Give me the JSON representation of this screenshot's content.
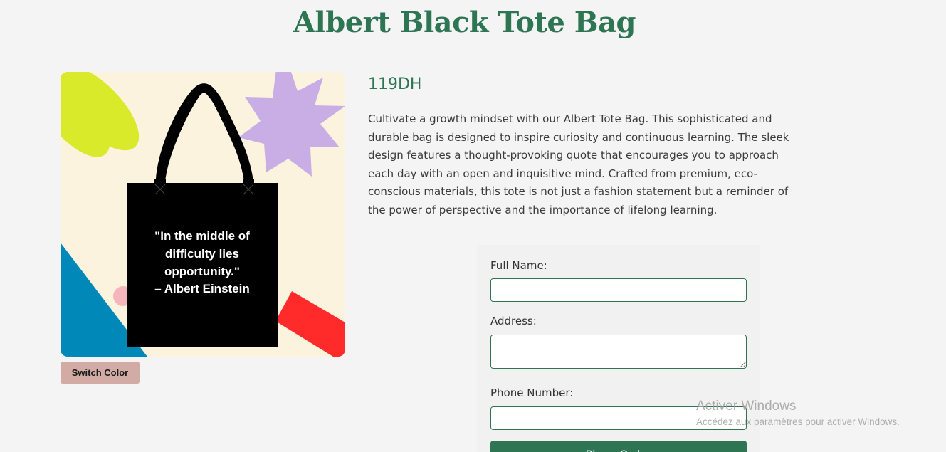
{
  "product": {
    "title": "Albert Black Tote Bag",
    "price": "119DH",
    "description": "Cultivate a growth mindset with our Albert Tote Bag. This sophisticated and durable bag is designed to inspire curiosity and continuous learning. The sleek design features a thought-provoking quote that encourages you to approach each day with an open and inquisitive mind. Crafted from premium, eco-conscious materials, this tote is not just a fashion statement but a reminder of the power of perspective and the importance of lifelong learning.",
    "image": {
      "quote_lines": [
        "\"In the middle of",
        "difficulty lies",
        "opportunity.\"",
        "– Albert Einstein"
      ],
      "bag_color": "#000000",
      "background_color": "#fbf3dd"
    },
    "switch_color_label": "Switch Color"
  },
  "form": {
    "full_name_label": "Full Name:",
    "full_name_value": "",
    "address_label": "Address:",
    "address_value": "",
    "phone_label": "Phone Number:",
    "phone_value": "",
    "submit_label": "Place Order"
  },
  "watermark": {
    "title": "Activer Windows",
    "subtitle": "Accédez aux paramètres pour activer Windows."
  },
  "colors": {
    "accent": "#2e7554",
    "switch_button": "#d2aca4",
    "page_background": "#f4f4f4"
  }
}
